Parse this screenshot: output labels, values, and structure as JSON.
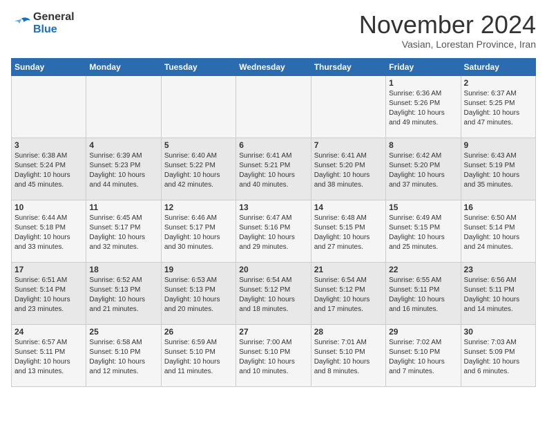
{
  "header": {
    "logo_line1": "General",
    "logo_line2": "Blue",
    "month": "November 2024",
    "location": "Vasian, Lorestan Province, Iran"
  },
  "weekdays": [
    "Sunday",
    "Monday",
    "Tuesday",
    "Wednesday",
    "Thursday",
    "Friday",
    "Saturday"
  ],
  "weeks": [
    [
      {
        "day": "",
        "info": ""
      },
      {
        "day": "",
        "info": ""
      },
      {
        "day": "",
        "info": ""
      },
      {
        "day": "",
        "info": ""
      },
      {
        "day": "",
        "info": ""
      },
      {
        "day": "1",
        "info": "Sunrise: 6:36 AM\nSunset: 5:26 PM\nDaylight: 10 hours\nand 49 minutes."
      },
      {
        "day": "2",
        "info": "Sunrise: 6:37 AM\nSunset: 5:25 PM\nDaylight: 10 hours\nand 47 minutes."
      }
    ],
    [
      {
        "day": "3",
        "info": "Sunrise: 6:38 AM\nSunset: 5:24 PM\nDaylight: 10 hours\nand 45 minutes."
      },
      {
        "day": "4",
        "info": "Sunrise: 6:39 AM\nSunset: 5:23 PM\nDaylight: 10 hours\nand 44 minutes."
      },
      {
        "day": "5",
        "info": "Sunrise: 6:40 AM\nSunset: 5:22 PM\nDaylight: 10 hours\nand 42 minutes."
      },
      {
        "day": "6",
        "info": "Sunrise: 6:41 AM\nSunset: 5:21 PM\nDaylight: 10 hours\nand 40 minutes."
      },
      {
        "day": "7",
        "info": "Sunrise: 6:41 AM\nSunset: 5:20 PM\nDaylight: 10 hours\nand 38 minutes."
      },
      {
        "day": "8",
        "info": "Sunrise: 6:42 AM\nSunset: 5:20 PM\nDaylight: 10 hours\nand 37 minutes."
      },
      {
        "day": "9",
        "info": "Sunrise: 6:43 AM\nSunset: 5:19 PM\nDaylight: 10 hours\nand 35 minutes."
      }
    ],
    [
      {
        "day": "10",
        "info": "Sunrise: 6:44 AM\nSunset: 5:18 PM\nDaylight: 10 hours\nand 33 minutes."
      },
      {
        "day": "11",
        "info": "Sunrise: 6:45 AM\nSunset: 5:17 PM\nDaylight: 10 hours\nand 32 minutes."
      },
      {
        "day": "12",
        "info": "Sunrise: 6:46 AM\nSunset: 5:17 PM\nDaylight: 10 hours\nand 30 minutes."
      },
      {
        "day": "13",
        "info": "Sunrise: 6:47 AM\nSunset: 5:16 PM\nDaylight: 10 hours\nand 29 minutes."
      },
      {
        "day": "14",
        "info": "Sunrise: 6:48 AM\nSunset: 5:15 PM\nDaylight: 10 hours\nand 27 minutes."
      },
      {
        "day": "15",
        "info": "Sunrise: 6:49 AM\nSunset: 5:15 PM\nDaylight: 10 hours\nand 25 minutes."
      },
      {
        "day": "16",
        "info": "Sunrise: 6:50 AM\nSunset: 5:14 PM\nDaylight: 10 hours\nand 24 minutes."
      }
    ],
    [
      {
        "day": "17",
        "info": "Sunrise: 6:51 AM\nSunset: 5:14 PM\nDaylight: 10 hours\nand 23 minutes."
      },
      {
        "day": "18",
        "info": "Sunrise: 6:52 AM\nSunset: 5:13 PM\nDaylight: 10 hours\nand 21 minutes."
      },
      {
        "day": "19",
        "info": "Sunrise: 6:53 AM\nSunset: 5:13 PM\nDaylight: 10 hours\nand 20 minutes."
      },
      {
        "day": "20",
        "info": "Sunrise: 6:54 AM\nSunset: 5:12 PM\nDaylight: 10 hours\nand 18 minutes."
      },
      {
        "day": "21",
        "info": "Sunrise: 6:54 AM\nSunset: 5:12 PM\nDaylight: 10 hours\nand 17 minutes."
      },
      {
        "day": "22",
        "info": "Sunrise: 6:55 AM\nSunset: 5:11 PM\nDaylight: 10 hours\nand 16 minutes."
      },
      {
        "day": "23",
        "info": "Sunrise: 6:56 AM\nSunset: 5:11 PM\nDaylight: 10 hours\nand 14 minutes."
      }
    ],
    [
      {
        "day": "24",
        "info": "Sunrise: 6:57 AM\nSunset: 5:11 PM\nDaylight: 10 hours\nand 13 minutes."
      },
      {
        "day": "25",
        "info": "Sunrise: 6:58 AM\nSunset: 5:10 PM\nDaylight: 10 hours\nand 12 minutes."
      },
      {
        "day": "26",
        "info": "Sunrise: 6:59 AM\nSunset: 5:10 PM\nDaylight: 10 hours\nand 11 minutes."
      },
      {
        "day": "27",
        "info": "Sunrise: 7:00 AM\nSunset: 5:10 PM\nDaylight: 10 hours\nand 10 minutes."
      },
      {
        "day": "28",
        "info": "Sunrise: 7:01 AM\nSunset: 5:10 PM\nDaylight: 10 hours\nand 8 minutes."
      },
      {
        "day": "29",
        "info": "Sunrise: 7:02 AM\nSunset: 5:10 PM\nDaylight: 10 hours\nand 7 minutes."
      },
      {
        "day": "30",
        "info": "Sunrise: 7:03 AM\nSunset: 5:09 PM\nDaylight: 10 hours\nand 6 minutes."
      }
    ]
  ]
}
